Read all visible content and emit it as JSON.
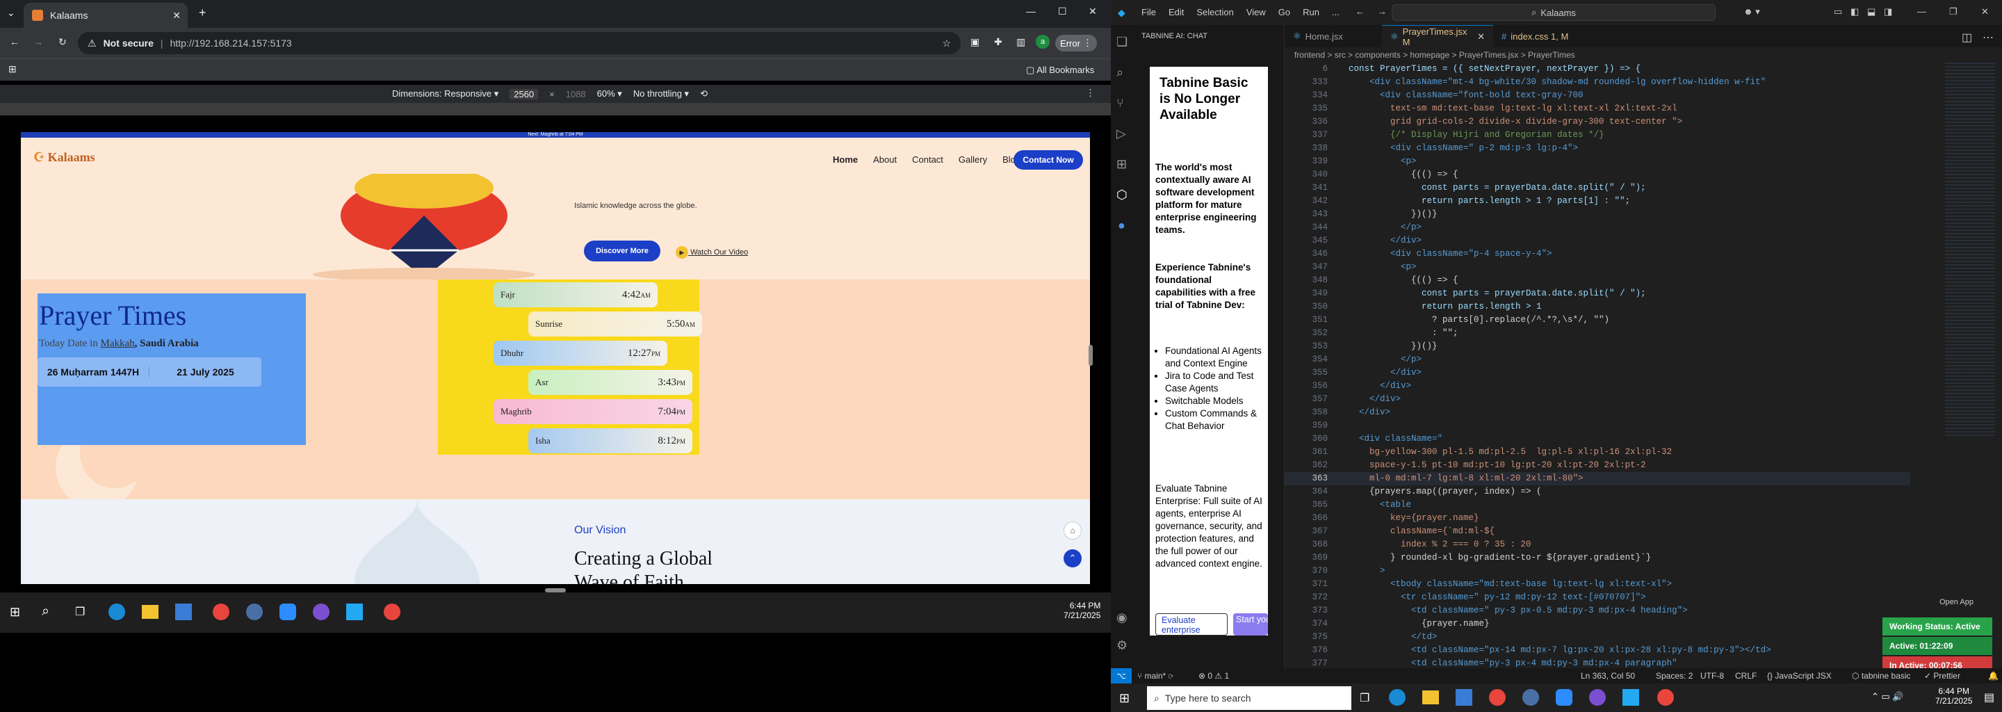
{
  "browser": {
    "tab_title": "Kalaams",
    "security": "Not secure",
    "url": "http://192.168.214.157:5173",
    "error_label": "Error",
    "bookmarks_label": "All Bookmarks"
  },
  "devtools": {
    "dimensions": "Dimensions: Responsive",
    "width": "2560",
    "height": "1088",
    "zoom": "60%",
    "throttle": "No throttling"
  },
  "site": {
    "topstrip": "Next: Maghrib at 7:04 PM",
    "logo": "Kalaams",
    "nav": [
      "Home",
      "About",
      "Contact",
      "Gallery",
      "Blogs"
    ],
    "contact_btn": "Contact Now",
    "hero_text": "Islamic knowledge across the globe.",
    "discover_btn": "Discover More",
    "watch_link": "Watch Our Video",
    "prayer_title": "Prayer Times",
    "date_prefix": "Today Date in",
    "city": "Makkah",
    "country": ", Saudi Arabia",
    "hijri": "26 Muḥarram 1447H",
    "gregorian": "21 July 2025",
    "prayers": [
      {
        "name": "Fajr",
        "time": "4:42",
        "ampm": "AM",
        "color": "#bfe0c4"
      },
      {
        "name": "Sunrise",
        "time": "5:50",
        "ampm": "AM",
        "color": "#f7ebc4"
      },
      {
        "name": "Dhuhr",
        "time": "12:27",
        "ampm": "PM",
        "color": "#9ec8f2"
      },
      {
        "name": "Asr",
        "time": "3:43",
        "ampm": "PM",
        "color": "#c8f0c0"
      },
      {
        "name": "Maghrib",
        "time": "7:04",
        "ampm": "PM",
        "color": "#f7b9d2"
      },
      {
        "name": "Isha",
        "time": "8:12",
        "ampm": "PM",
        "color": "#a6c9f0"
      }
    ],
    "vision_label": "Our Vision",
    "vision_title": "Creating a Global",
    "vision_title2": "Wave of Faith"
  },
  "left_taskbar": {
    "time": "6:44 PM",
    "date": "7/21/2025"
  },
  "vscode": {
    "menu": [
      "File",
      "Edit",
      "Selection",
      "View",
      "Go",
      "Run",
      "..."
    ],
    "search": "Kalaams",
    "chat_header": "TABNINE AI: CHAT",
    "tabnine": {
      "title": "Tabnine Basic is No Longer Available",
      "p1": "The world's most contextually aware AI software development platform for mature enterprise engineering teams.",
      "p2": "Experience Tabnine's foundational capabilities with a free trial of Tabnine Dev:",
      "bullets": [
        "Foundational AI Agents and Context Engine",
        "Jira to Code and Test Case Agents",
        "Switchable Models",
        "Custom Commands & Chat Behavior"
      ],
      "p3": "Evaluate Tabnine Enterprise: Full suite of AI agents, enterprise AI governance, security, and protection features, and the full power of our advanced context engine.",
      "btn1": "Evaluate enterprise",
      "btn2": "Start your Dev trial"
    },
    "tabs": [
      {
        "label": "Home.jsx"
      },
      {
        "label": "PrayerTimes.jsx M"
      },
      {
        "label": "index.css 1, M"
      }
    ],
    "breadcrumb": "frontend > src > components > homepage > PrayerTimes.jsx > PrayerTimes",
    "code_lines": [
      {
        "n": "6",
        "t": "const PrayerTimes = ({ setNextPrayer, nextPrayer }) => {"
      },
      {
        "n": "333",
        "t": "    <div className=\"mt-4 bg-white/30 shadow-md rounded-lg overflow-hidden w-fit\""
      },
      {
        "n": "334",
        "t": "      <div className=\"font-bold text-gray-700"
      },
      {
        "n": "335",
        "t": "        text-sm md:text-base lg:text-lg xl:text-xl 2xl:text-2xl"
      },
      {
        "n": "336",
        "t": "        grid grid-cols-2 divide-x divide-gray-300 text-center \">"
      },
      {
        "n": "337",
        "t": "        {/* Display Hijri and Gregorian dates */}"
      },
      {
        "n": "338",
        "t": "        <div className=\" p-2 md:p-3 lg:p-4\">"
      },
      {
        "n": "339",
        "t": "          <p>"
      },
      {
        "n": "340",
        "t": "            {(() => {"
      },
      {
        "n": "341",
        "t": "              const parts = prayerData.date.split(\" / \");"
      },
      {
        "n": "342",
        "t": "              return parts.length > 1 ? parts[1] : \"\";"
      },
      {
        "n": "343",
        "t": "            })()}"
      },
      {
        "n": "344",
        "t": "          </p>"
      },
      {
        "n": "345",
        "t": "        </div>"
      },
      {
        "n": "346",
        "t": "        <div className=\"p-4 space-y-4\">"
      },
      {
        "n": "347",
        "t": "          <p>"
      },
      {
        "n": "348",
        "t": "            {(() => {"
      },
      {
        "n": "349",
        "t": "              const parts = prayerData.date.split(\" / \");"
      },
      {
        "n": "350",
        "t": "              return parts.length > 1"
      },
      {
        "n": "351",
        "t": "                ? parts[0].replace(/^.*?,\\s*/, \"\")"
      },
      {
        "n": "352",
        "t": "                : \"\";"
      },
      {
        "n": "353",
        "t": "            })()}"
      },
      {
        "n": "354",
        "t": "          </p>"
      },
      {
        "n": "355",
        "t": "        </div>"
      },
      {
        "n": "356",
        "t": "      </div>"
      },
      {
        "n": "357",
        "t": "    </div>"
      },
      {
        "n": "358",
        "t": "  </div>"
      },
      {
        "n": "359",
        "t": ""
      },
      {
        "n": "360",
        "t": "  <div className=\""
      },
      {
        "n": "361",
        "t": "    bg-yellow-300 pl-1.5 md:pl-2.5  lg:pl-5 xl:pl-16 2xl:pl-32"
      },
      {
        "n": "362",
        "t": "    space-y-1.5 pt-10 md:pt-10 lg:pt-20 xl:pt-20 2xl:pt-2"
      },
      {
        "n": "363",
        "t": "    ml-0 md:ml-7 lg:ml-8 xl:ml-20 2xl:ml-80\">"
      },
      {
        "n": "364",
        "t": "    {prayers.map((prayer, index) => ("
      },
      {
        "n": "365",
        "t": "      <table"
      },
      {
        "n": "366",
        "t": "        key={prayer.name}"
      },
      {
        "n": "367",
        "t": "        className={`md:ml-${"
      },
      {
        "n": "368",
        "t": "          index % 2 === 0 ? 35 : 20"
      },
      {
        "n": "369",
        "t": "        } rounded-xl bg-gradient-to-r ${prayer.gradient}`}"
      },
      {
        "n": "370",
        "t": "      >"
      },
      {
        "n": "371",
        "t": "        <tbody className=\"md:text-base lg:text-lg xl:text-xl\">"
      },
      {
        "n": "372",
        "t": "          <tr className=\" py-12 md:py-12 text-[#070707]\">"
      },
      {
        "n": "373",
        "t": "            <td className=\" py-3 px-0.5 md:py-3 md:px-4 heading\">"
      },
      {
        "n": "374",
        "t": "              {prayer.name}"
      },
      {
        "n": "375",
        "t": "            </td>"
      },
      {
        "n": "376",
        "t": "            <td className=\"px-14 md:px-7 lg:px-20 xl:px-28 xl:py-8 md:py-3\"></td>"
      },
      {
        "n": "377",
        "t": "            <td className=\"py-3 px-4 md:py-3 md:px-4 paragraph\""
      }
    ],
    "status": {
      "branch": "main*",
      "problems": "0 ⚠ 1",
      "position": "Ln 363, Col 50",
      "spaces": "Spaces: 2",
      "encoding": "UTF-8",
      "eol": "CRLF",
      "language": "JavaScript JSX",
      "tabnine": "tabnine basic",
      "prettier": "Prettier"
    },
    "open_app": "Open App",
    "working": "Working Status: Active",
    "active": "Active: 01:22:09",
    "inactive": "In Active: 00:07:56"
  },
  "win_taskbar": {
    "search": "Type here to search",
    "time": "6:44 PM",
    "date": "7/21/2025"
  }
}
